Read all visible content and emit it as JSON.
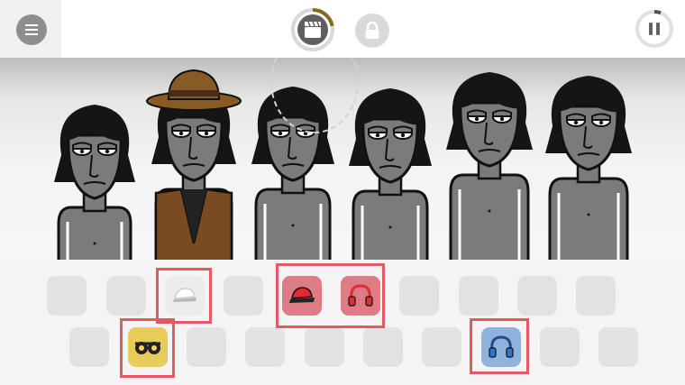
{
  "top_bar": {
    "menu_icon": "hamburger-icon",
    "record_icon": "clapperboard-icon",
    "lock_icon": "lock-icon",
    "pause_icon": "pause-icon",
    "record_progress": 0.22,
    "pause_progress": 0.06
  },
  "characters": [
    {
      "slot": 1,
      "outfit": "none"
    },
    {
      "slot": 2,
      "outfit": "brown-fedora-and-coat"
    },
    {
      "slot": 3,
      "outfit": "none"
    },
    {
      "slot": 4,
      "outfit": "none"
    },
    {
      "slot": 5,
      "outfit": "none"
    },
    {
      "slot": 6,
      "outfit": "none"
    }
  ],
  "sound_slots": {
    "row1": [
      {
        "icon": "empty"
      },
      {
        "icon": "empty"
      },
      {
        "icon": "white-cap-icon",
        "color": "#ececec",
        "highlighted": true
      },
      {
        "icon": "empty"
      },
      {
        "icon": "red-cap-icon",
        "color": "#de7c86",
        "highlighted": true
      },
      {
        "icon": "red-headphones-icon",
        "color": "#de7c86",
        "highlighted": true
      },
      {
        "icon": "empty"
      },
      {
        "icon": "empty"
      },
      {
        "icon": "empty"
      },
      {
        "icon": "empty"
      }
    ],
    "row2": [
      {
        "icon": "empty"
      },
      {
        "icon": "yellow-glasses-icon",
        "color": "#e7cc5a",
        "highlighted": true
      },
      {
        "icon": "empty"
      },
      {
        "icon": "empty"
      },
      {
        "icon": "empty"
      },
      {
        "icon": "empty"
      },
      {
        "icon": "empty"
      },
      {
        "icon": "blue-headphones-icon",
        "color": "#8fb3dc",
        "highlighted": true
      },
      {
        "icon": "empty"
      },
      {
        "icon": "empty"
      }
    ]
  },
  "colors": {
    "highlight": "#e35a63",
    "record_progress": "#8a6a1a",
    "brown_outfit": "#7a4a22"
  }
}
